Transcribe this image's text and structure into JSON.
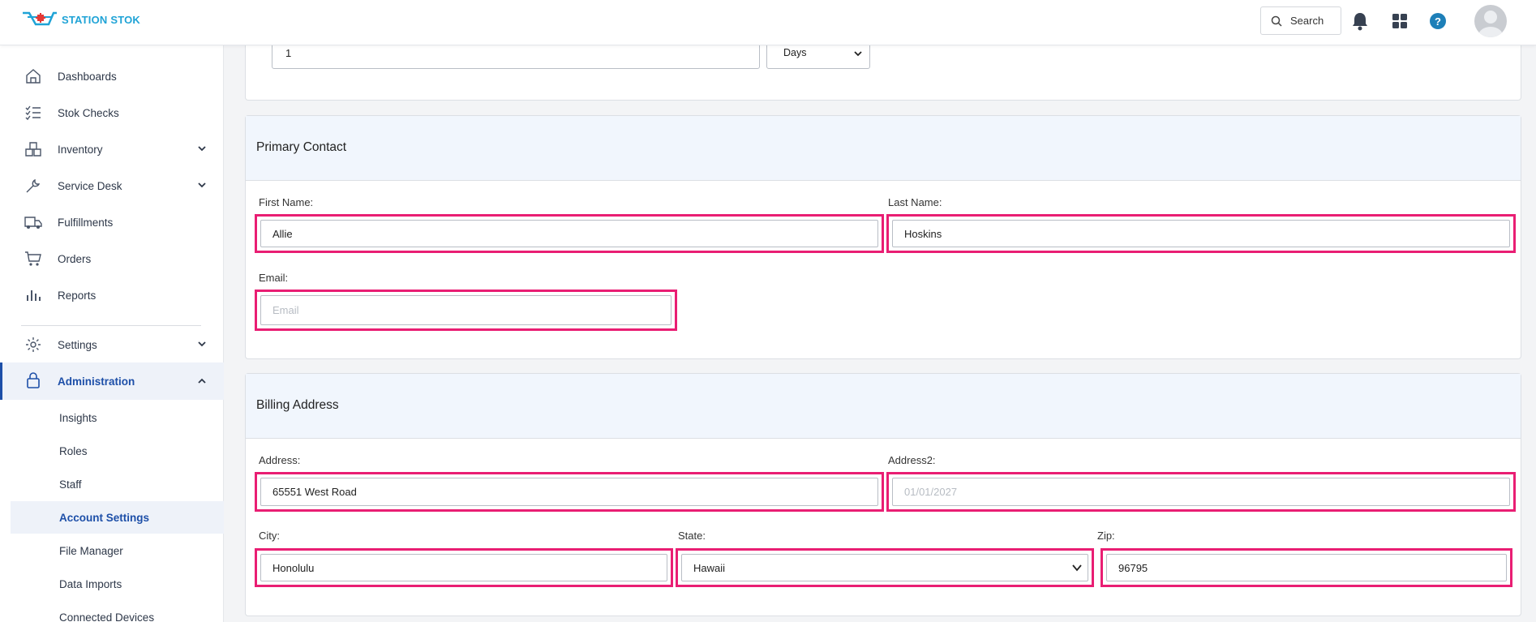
{
  "header": {
    "brand": "STATION STOK",
    "search_label": "Search"
  },
  "sidebar": {
    "items": [
      {
        "label": "Dashboards"
      },
      {
        "label": "Stok Checks"
      },
      {
        "label": "Inventory"
      },
      {
        "label": "Service Desk"
      },
      {
        "label": "Fulfillments"
      },
      {
        "label": "Orders"
      },
      {
        "label": "Reports"
      },
      {
        "label": "Settings"
      },
      {
        "label": "Administration"
      }
    ],
    "sub_items": [
      {
        "label": "Insights"
      },
      {
        "label": "Roles"
      },
      {
        "label": "Staff"
      },
      {
        "label": "Account Settings"
      },
      {
        "label": "File Manager"
      },
      {
        "label": "Data Imports"
      },
      {
        "label": "Connected Devices"
      }
    ]
  },
  "top_card": {
    "value": "1",
    "unit_select": "Days"
  },
  "primary_contact": {
    "title": "Primary Contact",
    "first_name_label": "First Name:",
    "first_name_value": "Allie",
    "last_name_label": "Last Name:",
    "last_name_value": "Hoskins",
    "email_label": "Email:",
    "email_placeholder": "Email"
  },
  "billing_address": {
    "title": "Billing Address",
    "address_label": "Address:",
    "address_value": "65551 West Road",
    "address2_label": "Address2:",
    "address2_placeholder": "01/01/2027",
    "city_label": "City:",
    "city_value": "Honolulu",
    "state_label": "State:",
    "state_value": "Hawaii",
    "zip_label": "Zip:",
    "zip_value": "96795"
  },
  "colors": {
    "highlight": "#e91e73",
    "accent": "#1d4fa8",
    "brand": "#1fa3d6"
  }
}
